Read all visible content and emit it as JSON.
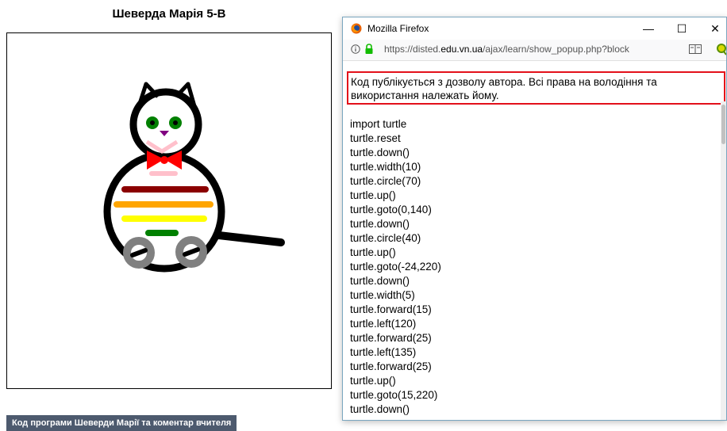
{
  "page": {
    "title": "Шеверда Марія 5-В",
    "code_button_label": "Код програми Шеверди Марії та коментар вчителя"
  },
  "popup": {
    "window_title": "Mozilla Firefox",
    "url_prefix": "https://disted.",
    "url_domain": "edu.vn.ua",
    "url_path": "/ajax/learn/show_popup.php?block",
    "notice": "Код публікується з дозволу автора. Всі права на володіння та використання належать йому.",
    "code_lines": [
      "import turtle",
      "turtle.reset",
      "turtle.down()",
      "turtle.width(10)",
      "turtle.circle(70)",
      "turtle.up()",
      "turtle.goto(0,140)",
      "turtle.down()",
      "turtle.circle(40)",
      "turtle.up()",
      "turtle.goto(-24,220)",
      "turtle.down()",
      "turtle.width(5)",
      "turtle.forward(15)",
      "turtle.left(120)",
      "turtle.forward(25)",
      "turtle.left(135)",
      "turtle.forward(25)",
      "turtle.up()",
      "turtle.goto(15,220)",
      "turtle.down()"
    ]
  },
  "colors": {
    "notice_border": "#e3101a",
    "button_bg": "#4d5a6e",
    "stripe_1": "#8b0000",
    "stripe_2": "#ffa500",
    "stripe_3": "#ffff00",
    "stripe_4": "#008000",
    "bow": "#ff0000",
    "eyes": "#008000",
    "nose": "#800080",
    "wheels": "#808080",
    "collar": "#ffc0cb"
  }
}
